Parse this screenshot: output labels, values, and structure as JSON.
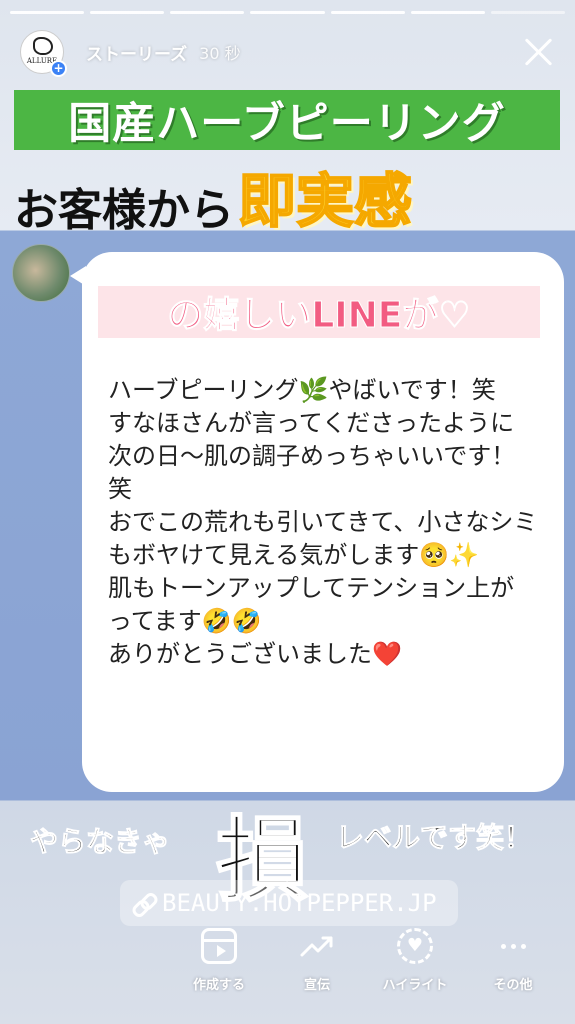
{
  "progress": {
    "segments": 7,
    "active": 6
  },
  "header": {
    "name": "ストーリーズ",
    "time": "30 秒",
    "avatar_text": "ALLURE"
  },
  "title_green": "国産ハーブピーリング",
  "subtitle": {
    "black": "お客様から",
    "yellow": "即実感"
  },
  "bubble": {
    "pink_title": "の嬉しいLINEが♡",
    "message": "ハーブピーリング🌿やばいです！笑\nすなほさんが言ってくださったように次の日〜肌の調子めっちゃいいです！笑\nおでこの荒れも引いてきて、小さなシミもボヤけて見える気がします🥺✨\n肌もトーンアップしてテンション上がってます🤣🤣\nありがとうございました❤️"
  },
  "bottom": {
    "left": "やらなきゃ",
    "big": "損",
    "right": "レベルです笑！"
  },
  "link": {
    "url": "BEAUTY.HOTPEPPER.JP"
  },
  "actions": [
    {
      "label": "作成する",
      "icon": "create-reel-icon"
    },
    {
      "label": "宣伝",
      "icon": "promote-trend-icon"
    },
    {
      "label": "ハイライト",
      "icon": "highlight-heart-icon"
    },
    {
      "label": "その他",
      "icon": "more-dots-icon"
    }
  ]
}
